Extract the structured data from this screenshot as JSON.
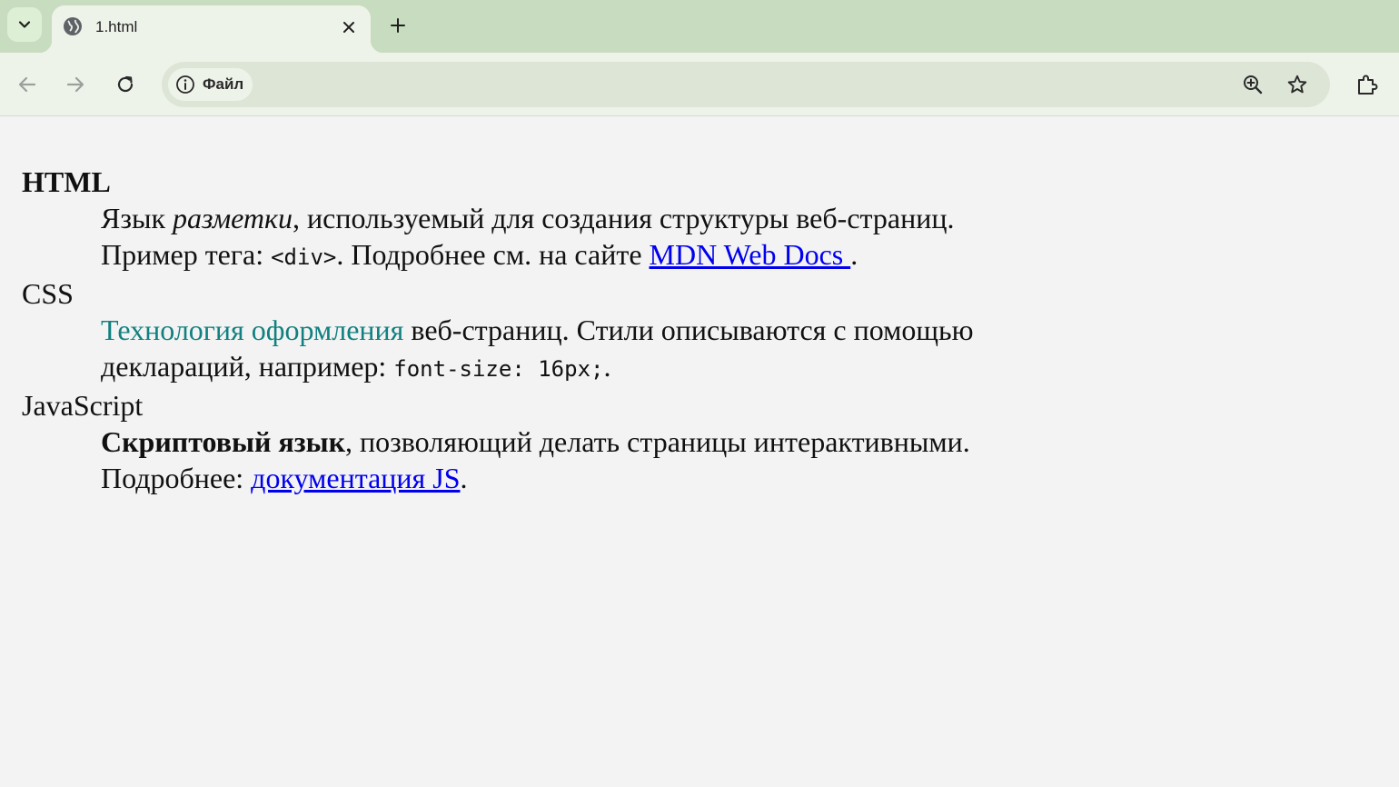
{
  "browser": {
    "tab_title": "1.html",
    "site_chip_label": "Файл"
  },
  "icons": {
    "tab_search": "chevron-down-icon",
    "favicon": "globe-icon",
    "tab_close": "close-icon",
    "new_tab": "plus-icon",
    "back": "arrow-left-icon",
    "forward": "arrow-right-icon",
    "reload": "reload-icon",
    "site_info": "info-icon",
    "zoom": "zoom-in-icon",
    "bookmark": "star-icon",
    "extensions": "puzzle-icon"
  },
  "colors": {
    "frame": "#c8ddc0",
    "toolbar": "#eef3ea",
    "link": "#0000ee",
    "teal_text": "#128080"
  },
  "page": {
    "html": {
      "term": "HTML",
      "def_1": "Язык ",
      "def_em": "разметки",
      "def_2": ", используемый для создания структуры веб-страниц. Пример тега: ",
      "def_code": "<div>",
      "def_3": ". Подробнее см. на сайте ",
      "link": "MDN Web Docs ",
      "def_4": "."
    },
    "css": {
      "term": "CSS",
      "def_teal": "Технология оформления",
      "def_1": " веб-страниц. Стили описываются с помощью деклараций, например: ",
      "def_code": "font-size: 16px;",
      "def_2": "."
    },
    "js": {
      "term": "JavaScript",
      "def_bold": "Скриптовый язык",
      "def_1": ", позволяющий делать страницы интерактивными. Подробнее: ",
      "link": "документация JS",
      "def_2": "."
    }
  }
}
